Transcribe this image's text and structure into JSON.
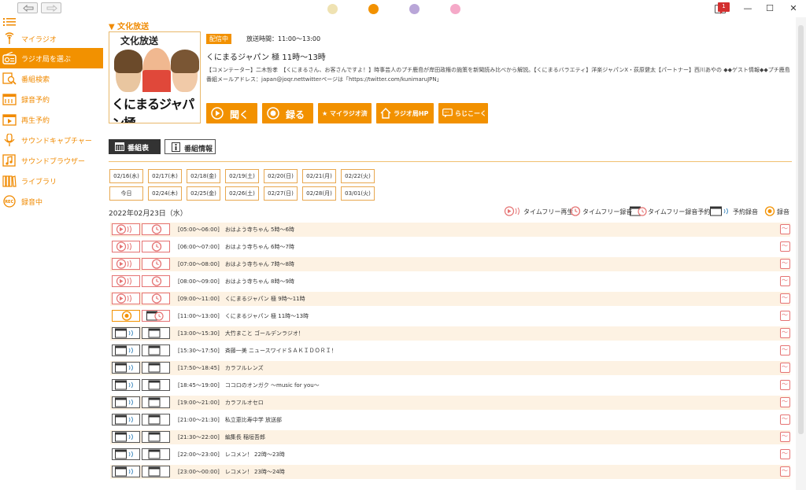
{
  "titlebar": {
    "notification_count": "1",
    "theme_colors": [
      "#efe2b2",
      "#f29100",
      "#b9a6d8",
      "#f5a9c8"
    ],
    "minimize": "—",
    "maximize": "☐",
    "close": "✕"
  },
  "sidebar": {
    "items": [
      {
        "label": "マイラジオ",
        "icon": "antenna-icon"
      },
      {
        "label": "ラジオ局を選ぶ",
        "icon": "radio-icon"
      },
      {
        "label": "番組検索",
        "icon": "search-icon"
      },
      {
        "label": "録音予約",
        "icon": "calendar-icon"
      },
      {
        "label": "再生予約",
        "icon": "play-calendar-icon"
      },
      {
        "label": "サウンドキャプチャー",
        "icon": "microphone-icon"
      },
      {
        "label": "サウンドブラウザー",
        "icon": "music-note-icon"
      },
      {
        "label": "ライブラリ",
        "icon": "library-icon"
      },
      {
        "label": "録音中",
        "icon": "rec-icon"
      }
    ]
  },
  "station": {
    "name": "文化放送",
    "image_logo": "文化放送",
    "image_title": "くにまるジャパン極",
    "onair_badge": "配信中",
    "broadcast_time": "放送時間：11:00〜13:00",
    "program_name": "くにまるジャパン 極 11時〜13時",
    "description": "【コメンテーター】二木哲孝　【くにまるさん、お客さんですよ！】時事芸人のプチ鹿島が岸田政権の施策を新聞読み比べから解説。【くにまるバラエティ】洋楽ジャパンX・荻原健太【パートナー】西川あやの ◆◆ゲスト情報◆◆プチ鹿島番組メールアドレス：japan@joqr.nettwitterページは「https://twitter.com/kunimaruJPN」"
  },
  "actions": {
    "listen": "聞く",
    "record": "録る",
    "myradio": "★ マイラジオ済",
    "station_hp": "ラジオ局HP",
    "radiko": "らじこーく"
  },
  "tabs": {
    "schedule": "番組表",
    "info": "番組情報"
  },
  "dates": {
    "row1": [
      "02/16(水)",
      "02/17(木)",
      "02/18(金)",
      "02/19(土)",
      "02/20(日)",
      "02/21(月)",
      "02/22(火)"
    ],
    "row2": [
      "今日",
      "02/24(木)",
      "02/25(金)",
      "02/26(土)",
      "02/27(日)",
      "02/28(月)",
      "03/01(火)"
    ]
  },
  "current_date": "2022年02月23日（水）",
  "legend": {
    "timefree_play": "タイムフリー再生",
    "timefree_record": "タイムフリー録音",
    "timefree_reserve": "タイムフリー録音予約",
    "reserve": "予約録音",
    "record": "録音"
  },
  "schedule": [
    {
      "time": "[05:00〜06:00]",
      "title": "おはよう寺ちゃん 5時〜6時",
      "kind": "past"
    },
    {
      "time": "[06:00〜07:00]",
      "title": "おはよう寺ちゃん 6時〜7時",
      "kind": "past"
    },
    {
      "time": "[07:00〜08:00]",
      "title": "おはよう寺ちゃん 7時〜8時",
      "kind": "past"
    },
    {
      "time": "[08:00〜09:00]",
      "title": "おはよう寺ちゃん 8時〜9時",
      "kind": "past"
    },
    {
      "time": "[09:00〜11:00]",
      "title": "くにまるジャパン 極 9時〜11時",
      "kind": "past"
    },
    {
      "time": "[11:00〜13:00]",
      "title": "くにまるジャパン 極 11時〜13時",
      "kind": "now"
    },
    {
      "time": "[13:00〜15:30]",
      "title": "大竹まこと ゴールデンラジオ！",
      "kind": "future"
    },
    {
      "time": "[15:30〜17:50]",
      "title": "斉藤一美 ニュースワイドＳＡＫＩＤＯＲＩ！",
      "kind": "future"
    },
    {
      "time": "[17:50〜18:45]",
      "title": "カラフルレンズ",
      "kind": "future"
    },
    {
      "time": "[18:45〜19:00]",
      "title": "ココロのオンガク 〜music for you〜",
      "kind": "future"
    },
    {
      "time": "[19:00〜21:00]",
      "title": "カラフルオセロ",
      "kind": "future"
    },
    {
      "time": "[21:00〜21:30]",
      "title": "私立恵比寿中学 放送部",
      "kind": "future"
    },
    {
      "time": "[21:30〜22:00]",
      "title": "編集長 稲垣吾郎",
      "kind": "future"
    },
    {
      "time": "[22:00〜23:00]",
      "title": "レコメン！ 22時〜23時",
      "kind": "future"
    },
    {
      "time": "[23:00〜00:00]",
      "title": "レコメン！ 23時〜24時",
      "kind": "future"
    }
  ]
}
